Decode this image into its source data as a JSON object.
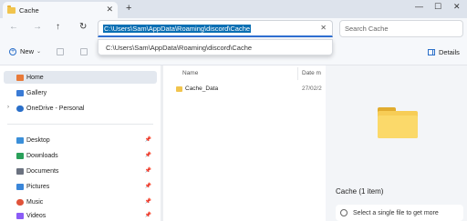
{
  "tab": {
    "title": "Cache",
    "close": "✕"
  },
  "tabbar": {
    "new_tab": "+"
  },
  "window": {
    "minimize": "—",
    "maximize": "☐",
    "close": "✕"
  },
  "nav": {
    "back": "←",
    "forward": "→",
    "up": "↑",
    "refresh": "↻"
  },
  "address": {
    "value": "C:\\Users\\Sam\\AppData\\Roaming\\discord\\Cache",
    "clear": "✕"
  },
  "suggestion": "C:\\Users\\Sam\\AppData\\Roaming\\discord\\Cache",
  "search": {
    "placeholder": "Search Cache"
  },
  "toolbar": {
    "new_label": "New",
    "plus": "+",
    "chevron": "⌄",
    "details_label": "Details"
  },
  "sidebar": {
    "items": [
      {
        "label": "Home",
        "icon": "home-icon",
        "color": "#e87a3a"
      },
      {
        "label": "Gallery",
        "icon": "gallery-icon",
        "color": "#3a7bd5"
      },
      {
        "label": "OneDrive - Personal",
        "icon": "cloud-icon",
        "color": "#2a6fc9",
        "expand": "›"
      },
      {
        "label": "Desktop",
        "icon": "desktop-icon",
        "color": "#3b8fd9",
        "pin": "📌"
      },
      {
        "label": "Downloads",
        "icon": "download-icon",
        "color": "#2aa05a",
        "pin": "📌"
      },
      {
        "label": "Documents",
        "icon": "document-icon",
        "color": "#6b7280",
        "pin": "📌"
      },
      {
        "label": "Pictures",
        "icon": "pictures-icon",
        "color": "#3a86d9",
        "pin": "📌"
      },
      {
        "label": "Music",
        "icon": "music-icon",
        "color": "#e0533a",
        "pin": "📌"
      },
      {
        "label": "Videos",
        "icon": "videos-icon",
        "color": "#8b5cf6",
        "pin": "📌"
      }
    ]
  },
  "filelist": {
    "columns": {
      "name": "Name",
      "date": "Date m"
    },
    "rows": [
      {
        "name": "Cache_Data",
        "date": "27/02/2"
      }
    ]
  },
  "preview": {
    "title": "Cache (1 item)",
    "info": "Select a single file to get more"
  },
  "colors": {
    "accent": "#2f6fd1",
    "selection": "#0a6fb3",
    "folder": "#f7cd56"
  }
}
